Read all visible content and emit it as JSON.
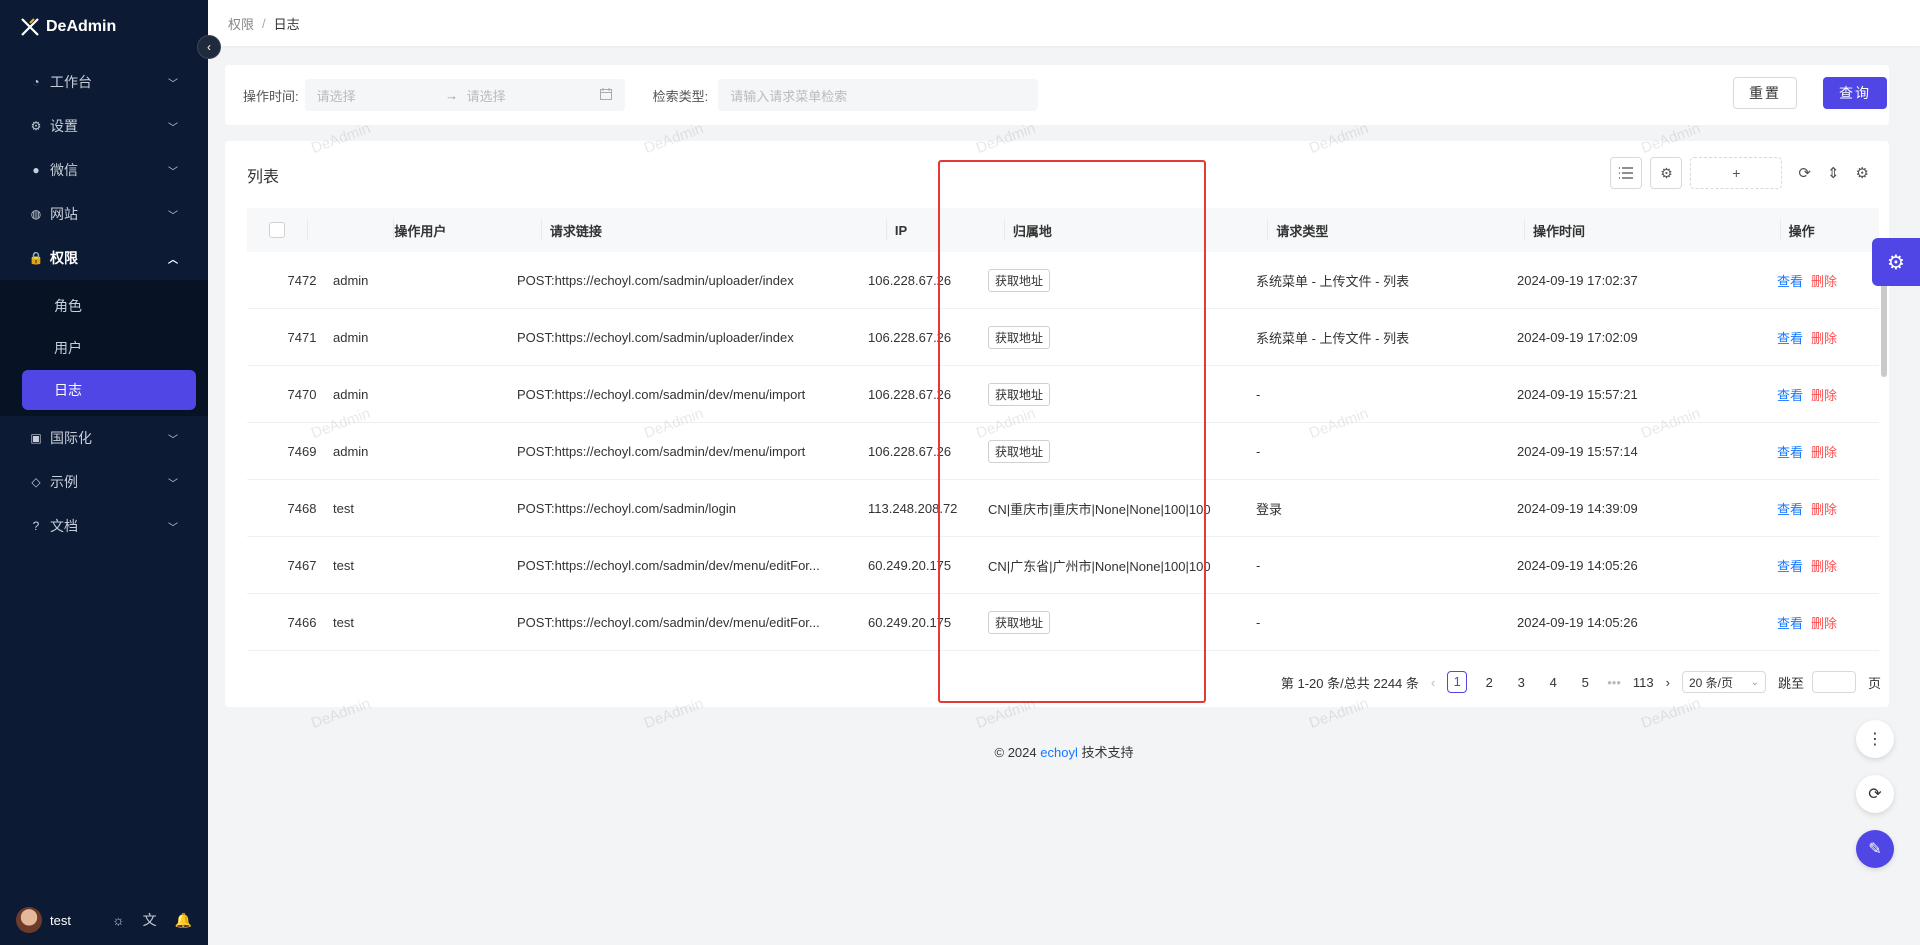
{
  "app": {
    "name": "DeAdmin"
  },
  "sidebar": {
    "items": [
      {
        "label": "工作台",
        "icon": "dashboard-icon"
      },
      {
        "label": "设置",
        "icon": "gear-icon"
      },
      {
        "label": "微信",
        "icon": "wechat-icon"
      },
      {
        "label": "网站",
        "icon": "globe-icon"
      },
      {
        "label": "权限",
        "icon": "lock-icon"
      },
      {
        "label": "国际化",
        "icon": "i18n-icon"
      },
      {
        "label": "示例",
        "icon": "tag-icon"
      },
      {
        "label": "文档",
        "icon": "help-icon"
      }
    ],
    "sub_items": [
      "角色",
      "用户",
      "日志"
    ],
    "user": "test"
  },
  "breadcrumb": {
    "parent": "权限",
    "separator": "/",
    "current": "日志"
  },
  "search": {
    "time_label": "操作时间:",
    "start_placeholder": "请选择",
    "end_placeholder": "请选择",
    "type_label": "检索类型:",
    "type_placeholder": "请输入请求菜单检索",
    "reset_label": "重置",
    "query_label": "查询"
  },
  "table": {
    "title": "列表",
    "plus_label": "+",
    "columns": [
      "操作用户",
      "请求链接",
      "IP",
      "归属地",
      "请求类型",
      "操作时间",
      "操作"
    ],
    "rows": [
      {
        "id": "7472",
        "user": "admin",
        "url": "POST:https://echoyl.com/sadmin/uploader/index",
        "ip": "106.228.67.26",
        "location": "获取地址",
        "location_is_button": true,
        "type": "系统菜单 - 上传文件 - 列表",
        "time": "2024-09-19 17:02:37"
      },
      {
        "id": "7471",
        "user": "admin",
        "url": "POST:https://echoyl.com/sadmin/uploader/index",
        "ip": "106.228.67.26",
        "location": "获取地址",
        "location_is_button": true,
        "type": "系统菜单 - 上传文件 - 列表",
        "time": "2024-09-19 17:02:09"
      },
      {
        "id": "7470",
        "user": "admin",
        "url": "POST:https://echoyl.com/sadmin/dev/menu/import",
        "ip": "106.228.67.26",
        "location": "获取地址",
        "location_is_button": true,
        "type": "-",
        "time": "2024-09-19 15:57:21"
      },
      {
        "id": "7469",
        "user": "admin",
        "url": "POST:https://echoyl.com/sadmin/dev/menu/import",
        "ip": "106.228.67.26",
        "location": "获取地址",
        "location_is_button": true,
        "type": "-",
        "time": "2024-09-19 15:57:14"
      },
      {
        "id": "7468",
        "user": "test",
        "url": "POST:https://echoyl.com/sadmin/login",
        "ip": "113.248.208.72",
        "location": "CN|重庆市|重庆市|None|None|100|100",
        "location_is_button": false,
        "type": "登录",
        "time": "2024-09-19 14:39:09"
      },
      {
        "id": "7467",
        "user": "test",
        "url": "POST:https://echoyl.com/sadmin/dev/menu/editFor...",
        "ip": "60.249.20.175",
        "location": "CN|广东省|广州市|None|None|100|100",
        "location_is_button": false,
        "type": "-",
        "time": "2024-09-19 14:05:26"
      },
      {
        "id": "7466",
        "user": "test",
        "url": "POST:https://echoyl.com/sadmin/dev/menu/editFor...",
        "ip": "60.249.20.175",
        "location": "获取地址",
        "location_is_button": true,
        "type": "-",
        "time": "2024-09-19 14:05:26"
      }
    ],
    "action_view": "查看",
    "action_delete": "删除"
  },
  "pagination": {
    "summary": "第 1-20 条/总共 2244 条",
    "pages": [
      "1",
      "2",
      "3",
      "4",
      "5"
    ],
    "ellipsis": "•••",
    "last": "113",
    "page_size": "20 条/页",
    "jump_label": "跳至",
    "page_suffix": "页"
  },
  "watermark": "DeAdmin",
  "footer": {
    "prefix": "© 2024",
    "brand": "echoyl",
    "suffix": "技术支持"
  },
  "colors": {
    "primary": "#4f46e5",
    "sidebar": "#0c1a33",
    "highlight": "#e53935",
    "link": "#1677ff",
    "danger": "#ff4d4f"
  }
}
